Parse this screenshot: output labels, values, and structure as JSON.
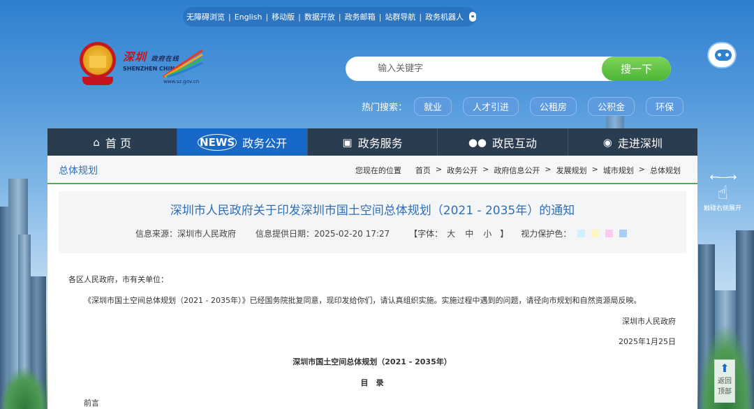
{
  "toplinks": [
    "无障碍浏览",
    "English",
    "移动版",
    "数据开放",
    "政务邮箱",
    "站群导航",
    "政务机器人"
  ],
  "logo": {
    "cn": "深圳",
    "cn_small": "政府在线",
    "en": "SHENZHEN CHINA",
    "url": "www.sz.gov.cn"
  },
  "search": {
    "placeholder": "输入关键字",
    "button": "搜一下"
  },
  "hot": {
    "label": "热门搜索：",
    "tags": [
      "就业",
      "人才引进",
      "公租房",
      "公积金",
      "环保"
    ]
  },
  "nav": [
    {
      "label": "首 页",
      "icon": "home-icon"
    },
    {
      "label": "政务公开",
      "icon": "news-icon"
    },
    {
      "label": "政务服务",
      "icon": "monitor-icon"
    },
    {
      "label": "政民互动",
      "icon": "people-icon"
    },
    {
      "label": "走进深圳",
      "icon": "chat-icon"
    }
  ],
  "nav_active": 1,
  "breadcrumb": {
    "section": "总体规划",
    "prefix": "您现在的位置",
    "items": [
      "首页",
      "政务公开",
      "政府信息公开",
      "发展规划",
      "城市规划",
      "总体规划"
    ]
  },
  "article": {
    "title": "深圳市人民政府关于印发深圳市国土空间总体规划（2021 - 2035年）的通知",
    "source": "信息来源：深圳市人民政府",
    "date": "信息提供日期：2025-02-20 17:27",
    "font_label": "【字体：",
    "font_sizes": [
      "大",
      "中",
      "小"
    ],
    "font_close": "】",
    "eye_label": "视力保护色：",
    "eye_colors": [
      "#ccf2ff",
      "#fff5c2",
      "#ffc8f0",
      "#a9cdf5"
    ],
    "greeting": "各区人民政府，市有关单位：",
    "paragraph": "《深圳市国土空间总体规划（2021 - 2035年）》已经国务院批复同意，现印发给你们，请认真组织实施。实施过程中遇到的问题，请径向市规划和自然资源局反映。",
    "signer": "深圳市人民政府",
    "sign_date": "2025年1月25日",
    "doc_heading": "深圳市国土空间总体规划（2021 - 2035年）",
    "toc": "目　录",
    "preface": "前言"
  },
  "side": {
    "expand": "触碰右侧展开",
    "backtop_1": "返回",
    "backtop_2": "顶部"
  }
}
